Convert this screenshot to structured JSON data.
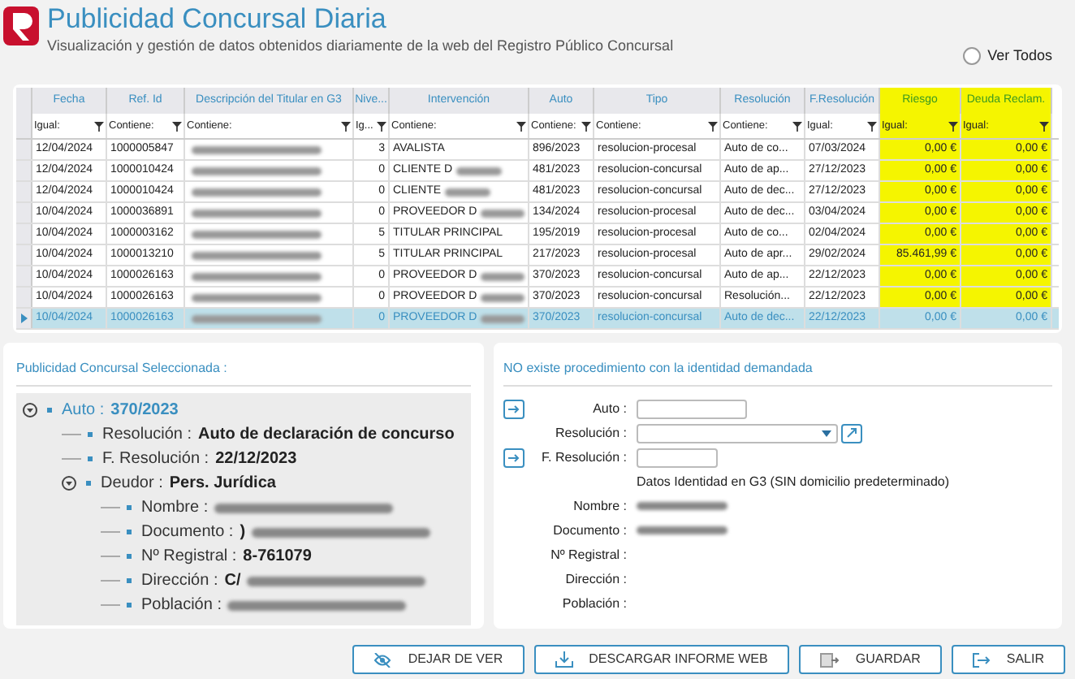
{
  "header": {
    "title": "Publicidad Concursal Diaria",
    "subtitle": "Visualización y gestión de datos obtenidos diariamente de la web del Registro Público Concursal",
    "ver_todos": {
      "label": "Ver Todos",
      "checked": false
    }
  },
  "table": {
    "columns": [
      {
        "label": "Fecha",
        "filter": "Igual:",
        "highlighted": false
      },
      {
        "label": "Ref. Id",
        "filter": "Contiene:",
        "highlighted": false
      },
      {
        "label": "Descripción del Titular en G3",
        "filter": "Contiene:",
        "highlighted": false
      },
      {
        "label": "Nive...",
        "filter": "Ig...",
        "highlighted": false
      },
      {
        "label": "Intervención",
        "filter": "Contiene:",
        "highlighted": false
      },
      {
        "label": "Auto",
        "filter": "Contiene:",
        "highlighted": false
      },
      {
        "label": "Tipo",
        "filter": "Contiene:",
        "highlighted": false
      },
      {
        "label": "Resolución",
        "filter": "Contiene:",
        "highlighted": false
      },
      {
        "label": "F.Resolución",
        "filter": "Igual:",
        "highlighted": false
      },
      {
        "label": "Riesgo",
        "filter": "Igual:",
        "highlighted": true
      },
      {
        "label": "Deuda Reclam.",
        "filter": "Igual:",
        "highlighted": true
      }
    ],
    "rows": [
      {
        "selected": false,
        "cells": [
          {
            "text": "12/04/2024"
          },
          {
            "text": "1000005847"
          },
          {
            "redacted": true
          },
          {
            "text": "3"
          },
          {
            "text": "AVALISTA"
          },
          {
            "text": "896/2023"
          },
          {
            "text": "resolucion-procesal"
          },
          {
            "text": "Auto de co..."
          },
          {
            "text": "07/03/2024"
          },
          {
            "text": "0,00 €"
          },
          {
            "text": "0,00 €"
          }
        ]
      },
      {
        "selected": false,
        "cells": [
          {
            "text": "12/04/2024"
          },
          {
            "text": "1000010424"
          },
          {
            "redacted": true
          },
          {
            "text": "0"
          },
          {
            "text": "CLIENTE D",
            "redacted": true
          },
          {
            "text": "481/2023"
          },
          {
            "text": "resolucion-concursal"
          },
          {
            "text": "Auto de ap..."
          },
          {
            "text": "27/12/2023"
          },
          {
            "text": "0,00 €"
          },
          {
            "text": "0,00 €"
          }
        ]
      },
      {
        "selected": false,
        "cells": [
          {
            "text": "12/04/2024"
          },
          {
            "text": "1000010424"
          },
          {
            "redacted": true
          },
          {
            "text": "0"
          },
          {
            "text": "CLIENTE",
            "redacted": true
          },
          {
            "text": "481/2023"
          },
          {
            "text": "resolucion-concursal"
          },
          {
            "text": "Auto de dec..."
          },
          {
            "text": "27/12/2023"
          },
          {
            "text": "0,00 €"
          },
          {
            "text": "0,00 €"
          }
        ]
      },
      {
        "selected": false,
        "cells": [
          {
            "text": "10/04/2024"
          },
          {
            "text": "1000036891"
          },
          {
            "redacted": true
          },
          {
            "text": "0"
          },
          {
            "text": "PROVEEDOR D",
            "redacted": true
          },
          {
            "text": "134/2024"
          },
          {
            "text": "resolucion-procesal"
          },
          {
            "text": "Auto de dec..."
          },
          {
            "text": "03/04/2024"
          },
          {
            "text": "0,00 €"
          },
          {
            "text": "0,00 €"
          }
        ]
      },
      {
        "selected": false,
        "cells": [
          {
            "text": "10/04/2024"
          },
          {
            "text": "1000003162"
          },
          {
            "redacted": true
          },
          {
            "text": "5"
          },
          {
            "text": "TITULAR PRINCIPAL"
          },
          {
            "text": "195/2019"
          },
          {
            "text": "resolucion-procesal"
          },
          {
            "text": "Auto de co..."
          },
          {
            "text": "02/04/2024"
          },
          {
            "text": "0,00 €"
          },
          {
            "text": "0,00 €"
          }
        ]
      },
      {
        "selected": false,
        "cells": [
          {
            "text": "10/04/2024"
          },
          {
            "text": "1000013210"
          },
          {
            "redacted": true
          },
          {
            "text": "5"
          },
          {
            "text": "TITULAR PRINCIPAL"
          },
          {
            "text": "217/2023"
          },
          {
            "text": "resolucion-procesal"
          },
          {
            "text": "Auto de apr..."
          },
          {
            "text": "29/02/2024"
          },
          {
            "text": "85.461,99 €"
          },
          {
            "text": "0,00 €"
          }
        ]
      },
      {
        "selected": false,
        "cells": [
          {
            "text": "10/04/2024"
          },
          {
            "text": "1000026163"
          },
          {
            "redacted": true
          },
          {
            "text": "0"
          },
          {
            "text": "PROVEEDOR D",
            "redacted": true
          },
          {
            "text": "370/2023"
          },
          {
            "text": "resolucion-concursal"
          },
          {
            "text": "Auto de ap..."
          },
          {
            "text": "22/12/2023"
          },
          {
            "text": "0,00 €"
          },
          {
            "text": "0,00 €"
          }
        ]
      },
      {
        "selected": false,
        "cells": [
          {
            "text": "10/04/2024"
          },
          {
            "text": "1000026163"
          },
          {
            "redacted": true
          },
          {
            "text": "0"
          },
          {
            "text": "PROVEEDOR D",
            "redacted": true
          },
          {
            "text": "370/2023"
          },
          {
            "text": "resolucion-concursal"
          },
          {
            "text": "Resolución..."
          },
          {
            "text": "22/12/2023"
          },
          {
            "text": "0,00 €"
          },
          {
            "text": "0,00 €"
          }
        ]
      },
      {
        "selected": true,
        "cells": [
          {
            "text": "10/04/2024"
          },
          {
            "text": "1000026163"
          },
          {
            "redacted": true
          },
          {
            "text": "0"
          },
          {
            "text": "PROVEEDOR D",
            "redacted": true
          },
          {
            "text": "370/2023"
          },
          {
            "text": "resolucion-concursal"
          },
          {
            "text": "Auto de dec..."
          },
          {
            "text": "22/12/2023"
          },
          {
            "text": "0,00 €"
          },
          {
            "text": "0,00 €"
          }
        ]
      }
    ]
  },
  "selected_panel": {
    "title": "Publicidad Concursal Seleccionada :",
    "tree": [
      {
        "label": "Auto :",
        "value": "370/2023",
        "expanded": true,
        "children": [
          {
            "label": "Resolución :",
            "value": "Auto de declaración de concurso"
          },
          {
            "label": "F. Resolución :",
            "value": "22/12/2023"
          },
          {
            "label": "Deudor :",
            "value": "Pers. Jurídica",
            "expanded": true,
            "children": [
              {
                "label": "Nombre :",
                "redacted": true
              },
              {
                "label": "Documento :",
                "value": ")",
                "redacted": true
              },
              {
                "label": "Nº Registral :",
                "value": "8-761079"
              },
              {
                "label": "Dirección :",
                "value": "C/",
                "redacted": true
              },
              {
                "label": "Población :",
                "redacted": true
              }
            ]
          }
        ]
      }
    ]
  },
  "identity_panel": {
    "title": "NO existe procedimiento con la identidad demandada",
    "fields": [
      {
        "kind": "input",
        "label": "Auto :"
      },
      {
        "kind": "select",
        "label": "Resolución :"
      },
      {
        "kind": "input",
        "label": "F. Resolución :"
      }
    ],
    "note": "Datos Identidad en G3 (SIN domicilio predeterminado)",
    "details": [
      {
        "label": "Nombre :",
        "redacted": true
      },
      {
        "label": "Documento :",
        "redacted": true
      },
      {
        "label": "Nº Registral :",
        "redacted": false
      },
      {
        "label": "Dirección :",
        "redacted": false
      },
      {
        "label": "Población :",
        "redacted": false
      }
    ]
  },
  "buttons": [
    {
      "label": "DEJAR DE VER"
    },
    {
      "label": "DESCARGAR INFORME WEB"
    },
    {
      "label": "GUARDAR"
    },
    {
      "label": "SALIR"
    }
  ]
}
